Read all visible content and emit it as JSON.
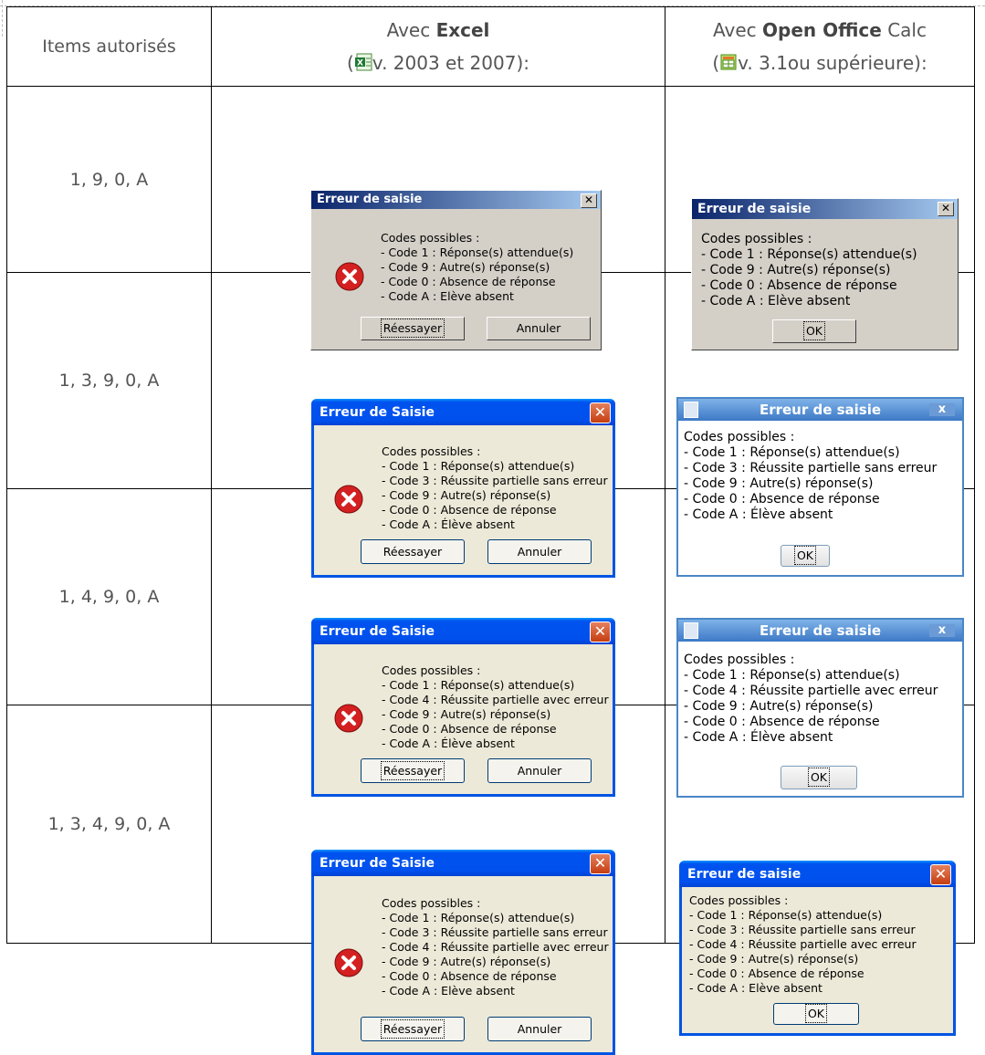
{
  "header": {
    "items_label": "Items autorisés",
    "excel_line1_pre": "Avec ",
    "excel_line1_bold": "Excel",
    "excel_line2_pre": "(",
    "excel_line2_post": "v. 2003 et 2007):",
    "oo_line1_pre": "Avec ",
    "oo_line1_bold": "Open Office",
    "oo_line1_post": " Calc",
    "oo_line2_pre": "(",
    "oo_line2_post": "v. 3.1ou supérieure):",
    "excel_icon": "excel-icon",
    "calc_icon": "calc-icon"
  },
  "rows": [
    {
      "items": "1, 9, 0, A",
      "excel": {
        "title": "Erreur de saisie",
        "codes": [
          "Codes possibles :",
          "- Code 1 : Réponse(s) attendue(s)",
          "- Code 9 : Autre(s) réponse(s)",
          "- Code 0 : Absence de réponse",
          "- Code A : Elève absent"
        ],
        "retry": "Réessayer",
        "cancel": "Annuler"
      },
      "oo": {
        "title": "Erreur de saisie",
        "codes": [
          "Codes possibles :",
          "- Code 1 : Réponse(s) attendue(s)",
          "- Code 9 : Autre(s) réponse(s)",
          "- Code 0 : Absence de réponse",
          "- Code A : Elève absent"
        ],
        "ok": "OK"
      }
    },
    {
      "items": "1, 3, 9, 0, A",
      "excel": {
        "title": "Erreur de Saisie",
        "codes": [
          "Codes possibles :",
          "- Code 1 : Réponse(s) attendue(s)",
          "- Code 3 : Réussite partielle sans erreur",
          "- Code 9 : Autre(s) réponse(s)",
          "- Code 0 : Absence de réponse",
          "- Code A : Élève absent"
        ],
        "retry": "Réessayer",
        "cancel": "Annuler"
      },
      "oo": {
        "title": "Erreur de saisie",
        "codes": [
          "Codes possibles :",
          "- Code 1 : Réponse(s) attendue(s)",
          "- Code 3 : Réussite partielle sans erreur",
          "- Code 9 : Autre(s) réponse(s)",
          "- Code 0 : Absence de réponse",
          "- Code A : Élève absent"
        ],
        "ok": "OK"
      }
    },
    {
      "items": "1, 4, 9, 0, A",
      "excel": {
        "title": "Erreur de Saisie",
        "codes": [
          "Codes possibles :",
          "- Code 1 : Réponse(s) attendue(s)",
          "- Code 4 : Réussite partielle avec erreur",
          "- Code 9 : Autre(s) réponse(s)",
          "- Code 0 : Absence de réponse",
          "- Code A : Élève absent"
        ],
        "retry": "Réessayer",
        "cancel": "Annuler"
      },
      "oo": {
        "title": "Erreur de saisie",
        "codes": [
          "Codes possibles :",
          "- Code 1 : Réponse(s) attendue(s)",
          "- Code 4 : Réussite partielle avec erreur",
          "- Code 9 : Autre(s) réponse(s)",
          "- Code 0 : Absence de réponse",
          "- Code A : Élève absent"
        ],
        "ok": "OK"
      }
    },
    {
      "items": "1, 3, 4, 9, 0, A",
      "excel": {
        "title": "Erreur de Saisie",
        "codes": [
          "Codes possibles :",
          "- Code 1 : Réponse(s) attendue(s)",
          "- Code 3 : Réussite partielle sans erreur",
          "- Code 4 : Réussite partielle avec erreur",
          "- Code 9 : Autre(s) réponse(s)",
          "- Code 0 : Absence de réponse",
          "- Code A : Elève absent"
        ],
        "retry": "Réessayer",
        "cancel": "Annuler"
      },
      "oo": {
        "title": "Erreur de saisie",
        "codes": [
          "Codes possibles :",
          "- Code 1 : Réponse(s) attendue(s)",
          "- Code 3 : Réussite partielle sans erreur",
          "- Code 4 : Réussite partielle avec erreur",
          "- Code 9 : Autre(s) réponse(s)",
          "- Code 0 : Absence de réponse",
          "- Code A : Elève absent"
        ],
        "ok": "OK"
      }
    }
  ],
  "icons": {
    "dialog_error": "error-x-icon",
    "close": "close-icon"
  },
  "colors": {
    "xp_title": "#0054e3",
    "classic_title": "#0a246a",
    "error_red": "#d42020",
    "cell_border": "#000000",
    "text_gray": "#555555"
  }
}
